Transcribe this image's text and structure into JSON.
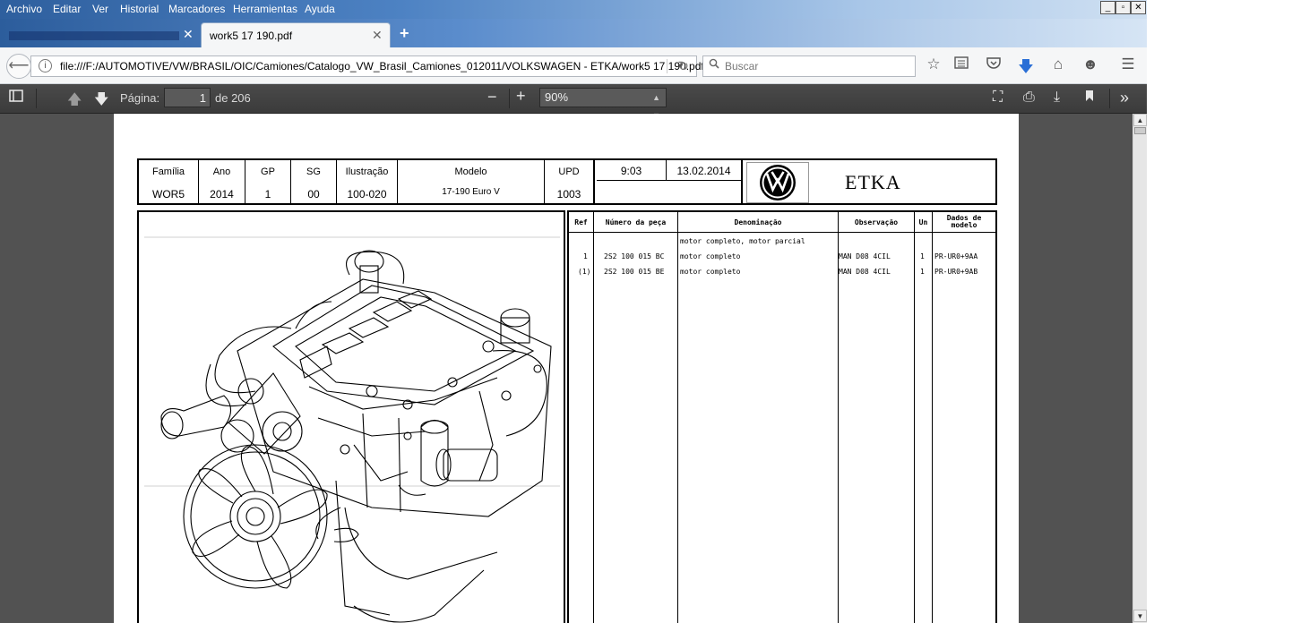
{
  "menu": [
    "Archivo",
    "Editar",
    "Ver",
    "Historial",
    "Marcadores",
    "Herramientas",
    "Ayuda"
  ],
  "window_controls": {
    "minimize": "_",
    "maximize": "▫",
    "close": "✕"
  },
  "tabs": {
    "active_title": "work5 17 190.pdf",
    "close_glyph": "✕",
    "new_tab_glyph": "+"
  },
  "nav": {
    "url": "file:///F:/AUTOMOTIVE/VW/BRASIL/OIC/Camiones/Catalogo_VW_Brasil_Camiones_012011/VOLKSWAGEN - ETKA/work5 17 190.pdf",
    "search_placeholder": "Buscar"
  },
  "pdf_toolbar": {
    "page_label": "Página:",
    "page_current": "1",
    "page_of": "de 206",
    "zoom": "90%"
  },
  "document": {
    "header_columns": [
      {
        "label": "Família",
        "value": "WOR5"
      },
      {
        "label": "Ano",
        "value": "2014"
      },
      {
        "label": "GP",
        "value": "1"
      },
      {
        "label": "SG",
        "value": "00"
      },
      {
        "label": "Ilustração",
        "value": "100-020"
      },
      {
        "label": "Modelo",
        "value": "17-190 Euro V"
      },
      {
        "label": "UPD",
        "value": "1003"
      }
    ],
    "time": "9:03",
    "date": "13.02.2014",
    "brand_text": "ETKA",
    "parts_headers": {
      "ref": "Ref",
      "number": "Número da peça",
      "name": "Denominação",
      "obs": "Observação",
      "un": "Un",
      "model_data": "Dados de modelo"
    },
    "parts_section": "motor completo, motor parcial",
    "parts": [
      {
        "ref": "1",
        "number": "2S2 100 015 BC",
        "name": "motor completo",
        "obs": "MAN D08 4CIL",
        "un": "1",
        "model_data": "PR-UR0+9AA"
      },
      {
        "ref": "(1)",
        "number": "2S2 100 015 BE",
        "name": "motor completo",
        "obs": "MAN D08 4CIL",
        "un": "1",
        "model_data": "PR-UR0+9AB"
      }
    ]
  }
}
